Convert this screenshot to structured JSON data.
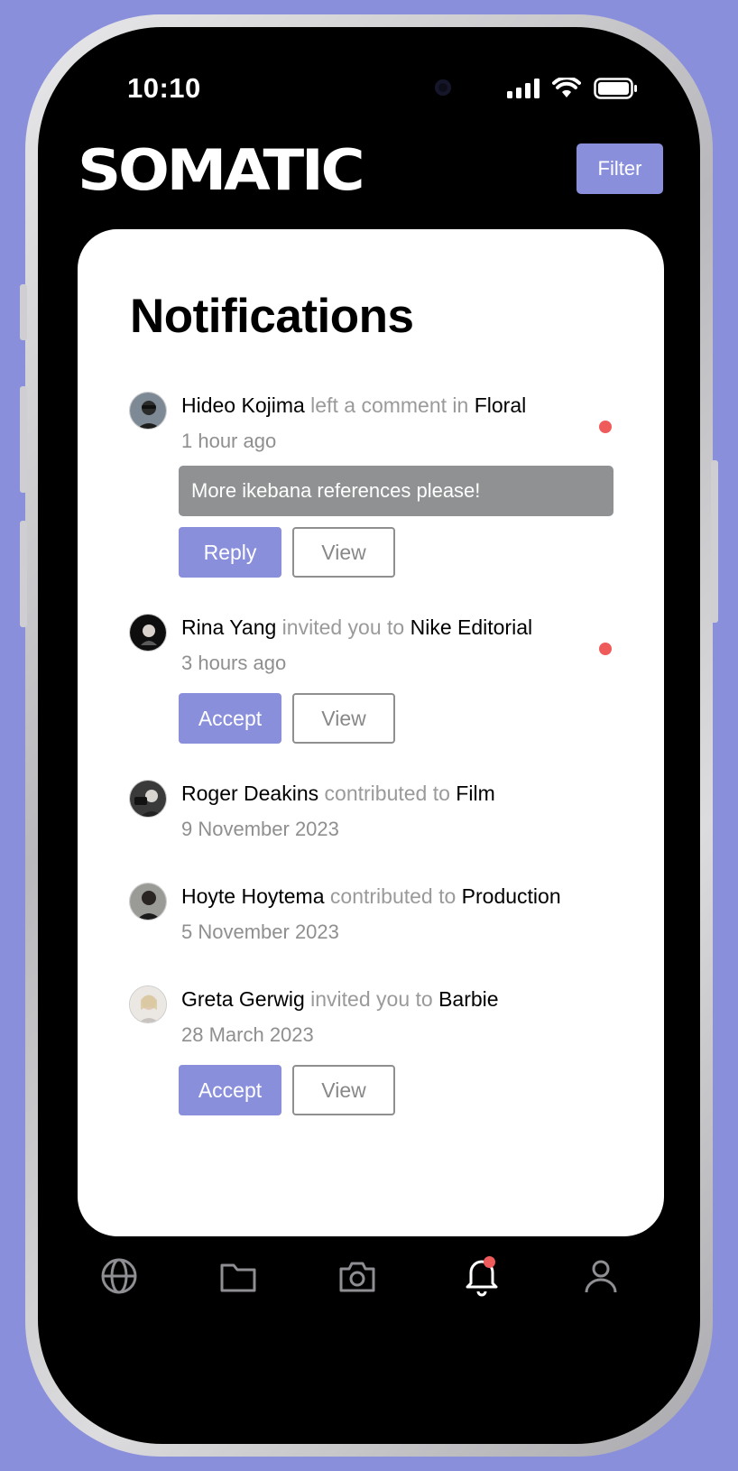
{
  "status_bar": {
    "time": "10:10"
  },
  "header": {
    "logo": "SOMATIC",
    "filter_label": "Filter"
  },
  "card": {
    "title": "Notifications"
  },
  "notifications": [
    {
      "user": "Hideo Kojima",
      "action": " left a comment in ",
      "target": "Floral",
      "time": "1 hour ago",
      "unread": true,
      "comment": "More ikebana references please!",
      "primary_label": "Reply",
      "secondary_label": "View"
    },
    {
      "user": "Rina Yang",
      "action": " invited you to ",
      "target": "Nike Editorial",
      "time": "3 hours ago",
      "unread": true,
      "primary_label": "Accept",
      "secondary_label": "View"
    },
    {
      "user": "Roger Deakins",
      "action": " contributed to ",
      "target": "Film",
      "time": "9 November 2023",
      "unread": false
    },
    {
      "user": "Hoyte Hoytema",
      "action": " contributed to ",
      "target": "Production",
      "time": "5 November 2023",
      "unread": false
    },
    {
      "user": "Greta Gerwig",
      "action": " invited you to ",
      "target": "Barbie",
      "time": "28 March 2023",
      "unread": false,
      "primary_label": "Accept",
      "secondary_label": "View"
    }
  ],
  "tab_bar": {
    "items": [
      "globe-icon",
      "folder-icon",
      "camera-icon",
      "bell-icon",
      "profile-icon"
    ],
    "active": "bell-icon"
  },
  "colors": {
    "accent": "#8a8fdc",
    "unread": "#ef5b5b",
    "background": "#8a8fdc"
  }
}
